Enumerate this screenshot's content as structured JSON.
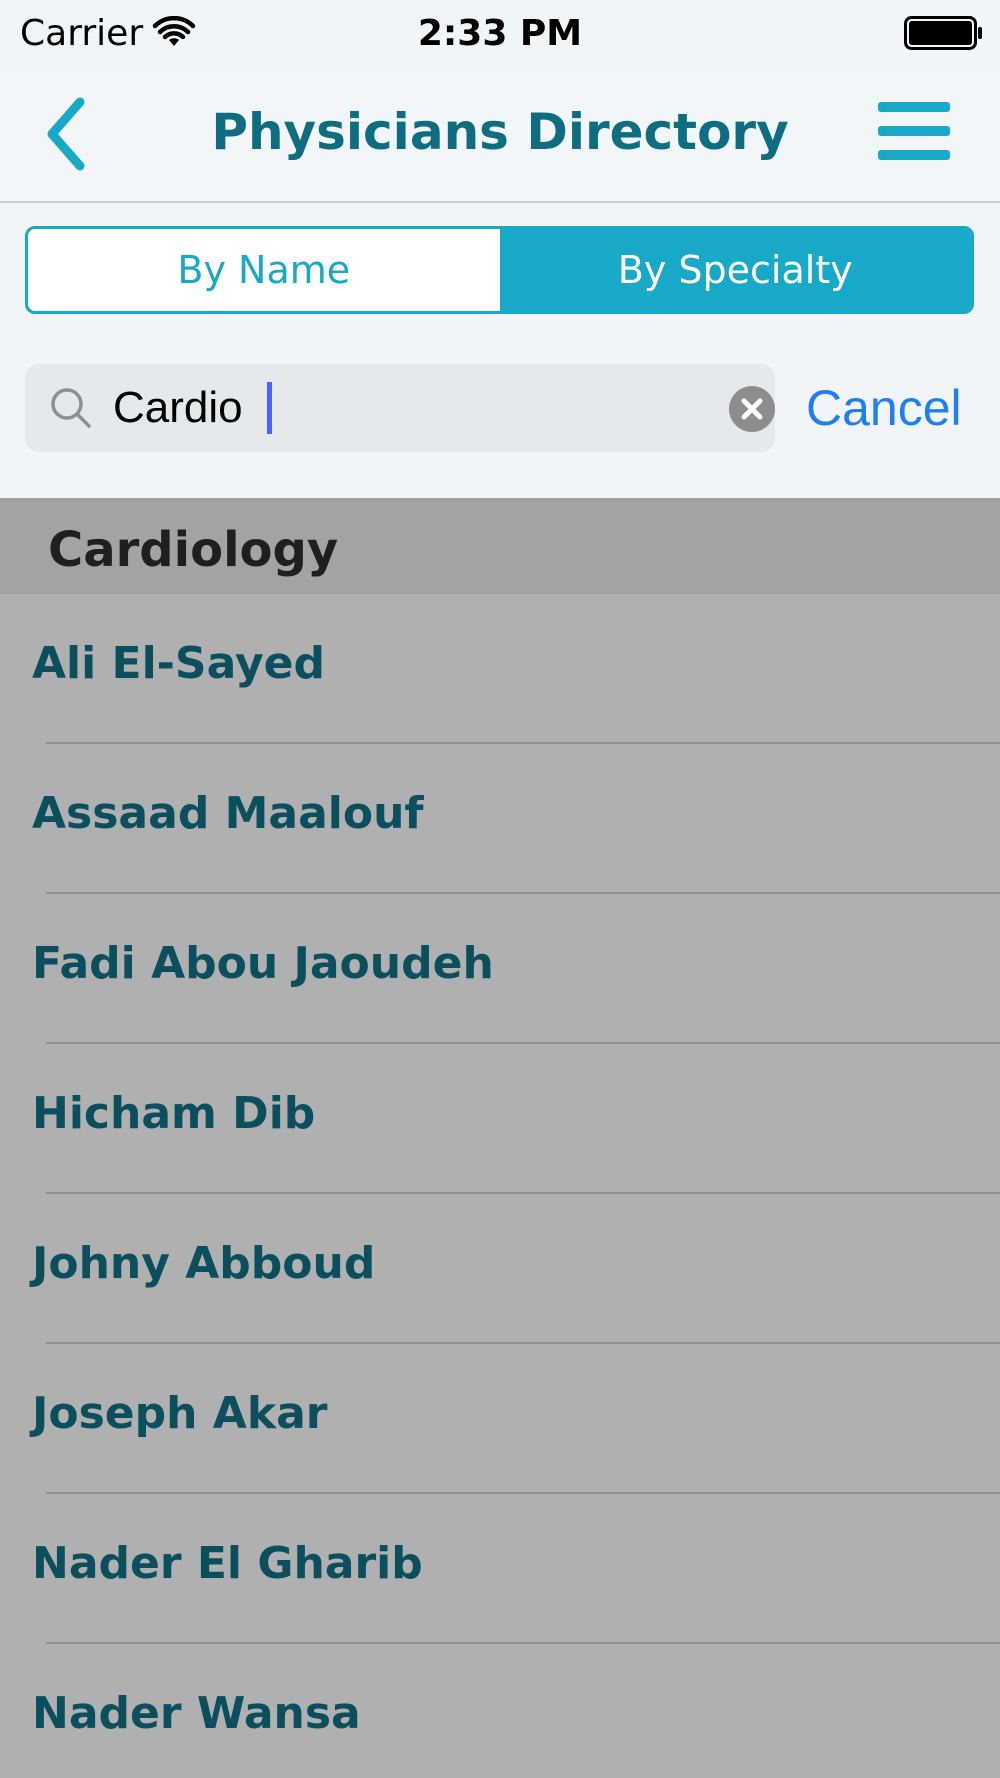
{
  "status_bar": {
    "carrier": "Carrier",
    "time": "2:33 PM"
  },
  "nav": {
    "title": "Physicians Directory"
  },
  "segments": {
    "by_name": "By Name",
    "by_specialty": "By Specialty",
    "selected": "By Specialty"
  },
  "search": {
    "value": "Cardio",
    "cancel_label": "Cancel"
  },
  "results": {
    "section_title": "Cardiology",
    "items": [
      {
        "label": "Ali El-Sayed"
      },
      {
        "label": "Assaad Maalouf"
      },
      {
        "label": "Fadi Abou Jaoudeh"
      },
      {
        "label": "Hicham Dib"
      },
      {
        "label": "Johny Abboud"
      },
      {
        "label": "Joseph Akar"
      },
      {
        "label": "Nader El Gharib"
      },
      {
        "label": "Nader Wansa"
      }
    ]
  },
  "colors": {
    "accent": "#17a9c7",
    "title": "#0e6d80",
    "cancel": "#1f7ef7",
    "list_text": "#0b4f5e",
    "overlay": "#b0b0b0"
  },
  "icons": {
    "back": "chevron-left-icon",
    "menu": "hamburger-menu-icon",
    "search": "search-icon",
    "clear": "clear-icon",
    "wifi": "wifi-icon",
    "battery": "battery-icon"
  }
}
